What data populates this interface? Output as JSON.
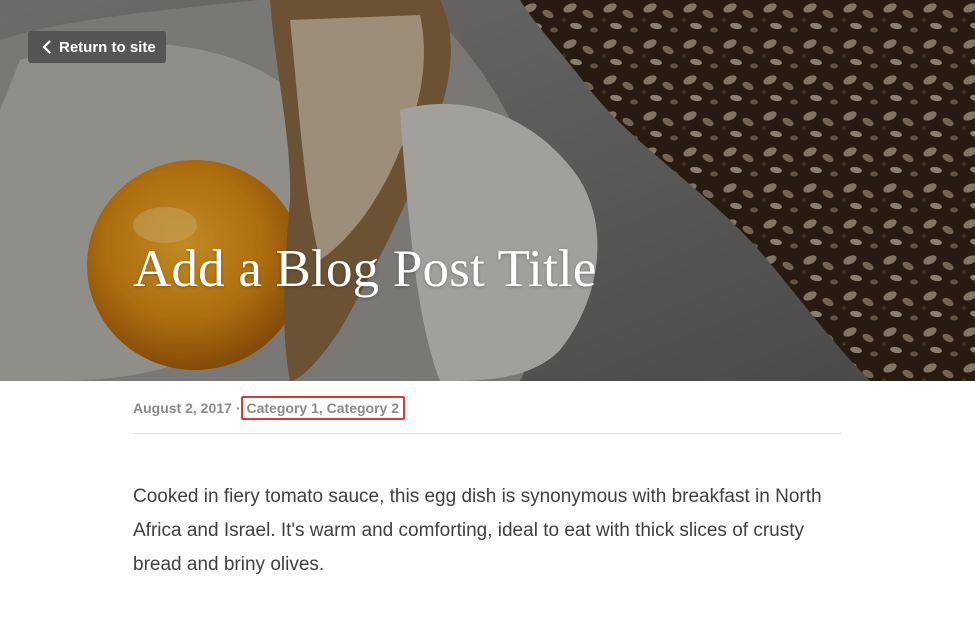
{
  "return_button": {
    "label": "Return to site",
    "icon": "chevron-left-icon"
  },
  "post": {
    "title": "Add a Blog Post Title",
    "date": "August 2, 2017",
    "separator": "·",
    "categories": [
      "Category 1",
      "Category 2"
    ],
    "category_delimiter": ", ",
    "body": "Cooked in fiery tomato sauce, this egg dish is synonymous with breakfast in North Africa and Israel. It's warm and comforting, ideal to eat with thick slices of crusty bread and briny olives."
  },
  "colors": {
    "highlight_border": "#e0363b",
    "meta_text": "#8a8a8a",
    "body_text": "#3f3f3f"
  }
}
